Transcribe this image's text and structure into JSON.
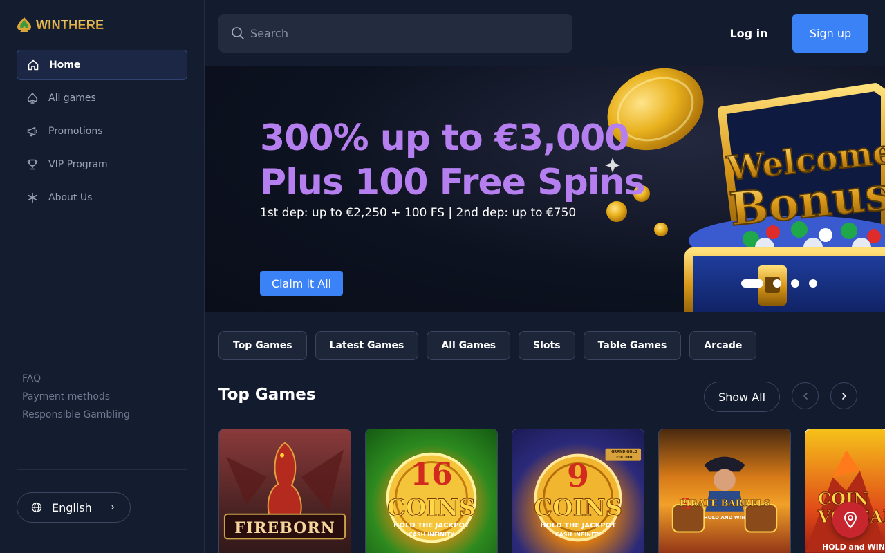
{
  "brand": {
    "name": "WINTHERE"
  },
  "sidebar": {
    "items": [
      {
        "label": "Home",
        "icon": "home-icon",
        "active": true
      },
      {
        "label": "All games",
        "icon": "spade-icon"
      },
      {
        "label": "Promotions",
        "icon": "megaphone-icon"
      },
      {
        "label": "VIP Program",
        "icon": "trophy-icon"
      },
      {
        "label": "About Us",
        "icon": "asterisk-icon"
      }
    ],
    "footer_links": [
      "FAQ",
      "Payment methods",
      "Responsible Gambling"
    ],
    "language": "English"
  },
  "header": {
    "search_placeholder": "Search",
    "login_label": "Log in",
    "signup_label": "Sign up"
  },
  "banner": {
    "headline_line1": "300% up to €3,000",
    "headline_line2": "Plus 100 Free Spins",
    "subtitle": "1st dep: up to €2,250 + 100 FS | 2nd dep: up to €750",
    "cta_label": "Claim it All",
    "art_text_line1": "Welcome",
    "art_text_line2": "Bonus",
    "slide_count": 4,
    "active_slide": 1
  },
  "tabs": [
    "Top Games",
    "Latest Games",
    "All Games",
    "Slots",
    "Table Games",
    "Arcade"
  ],
  "section": {
    "title": "Top Games",
    "show_all_label": "Show All"
  },
  "games": [
    {
      "title": "FIREBORN"
    },
    {
      "title_top": "16",
      "title_main": "COINS",
      "tagline": "HOLD THE JACKPOT",
      "subtag": "CASH INFINITY"
    },
    {
      "title_top": "9",
      "title_main": "COINS",
      "tagline": "HOLD THE JACKPOT",
      "subtag": "CASH INFINITY",
      "badge": "GRAND GOLD EDITION"
    },
    {
      "title_top": "3",
      "title_main": "PIRATE BARRELS",
      "tagline": "HOLD AND WIN"
    },
    {
      "title_main": "COIN VOLCANO",
      "tagline": "HOLD and WIN"
    }
  ],
  "colors": {
    "accent_blue": "#3b82f6",
    "headline_purple": "#b57ff0",
    "background": "#131b2e",
    "support_red": "#c8262f"
  }
}
